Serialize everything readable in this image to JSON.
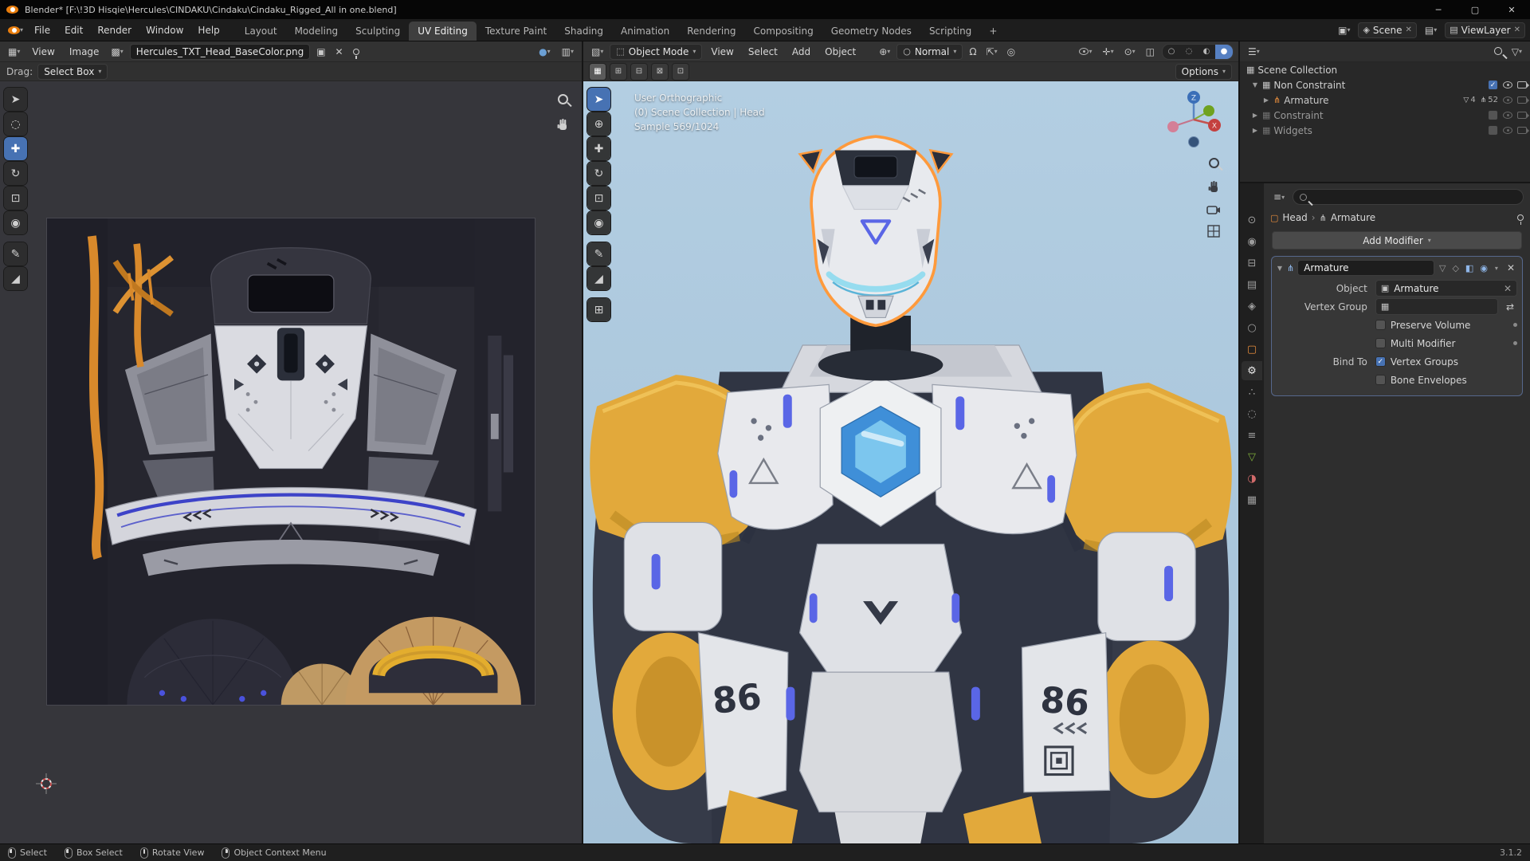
{
  "titlebar": {
    "title": "Blender* [F:\\!3D Hisqie\\Hercules\\CINDAKU\\Cindaku\\Cindaku_Rigged_All in one.blend]",
    "minimize": "─",
    "maximize": "▢",
    "close": "✕"
  },
  "topbar": {
    "menus": [
      "File",
      "Edit",
      "Render",
      "Window",
      "Help"
    ],
    "workspaces": [
      "Layout",
      "Modeling",
      "Sculpting",
      "UV Editing",
      "Texture Paint",
      "Shading",
      "Animation",
      "Rendering",
      "Compositing",
      "Geometry Nodes",
      "Scripting"
    ],
    "add_tab": "+",
    "scene_label": "Scene",
    "viewlayer_label": "ViewLayer"
  },
  "uv_editor": {
    "menu_view": "View",
    "menu_image": "Image",
    "image_name": "Hercules_TXT_Head_BaseColor.png",
    "drag_label": "Drag:",
    "drag_value": "Select Box"
  },
  "viewport": {
    "mode": "Object Mode",
    "menus": [
      "View",
      "Select",
      "Add",
      "Object"
    ],
    "orientation": "Normal",
    "options_label": "Options",
    "overlay_line1": "User Orthographic",
    "overlay_line2": "(0) Scene Collection | Head",
    "overlay_line3": "Sample 569/1024",
    "gizmo_axes": {
      "z": "Z",
      "x": "X"
    }
  },
  "outliner": {
    "scene_collection": "Scene Collection",
    "rows": [
      {
        "label": "Non Constraint"
      },
      {
        "label": "Armature",
        "count1": "4",
        "count2": "52"
      },
      {
        "label": "Constraint"
      },
      {
        "label": "Widgets"
      }
    ]
  },
  "properties": {
    "breadcrumb_object": "Head",
    "breadcrumb_modifier": "Armature",
    "add_modifier_label": "Add Modifier",
    "modifier": {
      "name": "Armature",
      "object_label": "Object",
      "object_value": "Armature",
      "vertex_group_label": "Vertex Group",
      "preserve_volume_label": "Preserve Volume",
      "multi_modifier_label": "Multi Modifier",
      "bind_to_label": "Bind To",
      "vertex_groups_label": "Vertex Groups",
      "bone_envelopes_label": "Bone Envelopes"
    }
  },
  "statusbar": {
    "hints": [
      "Select",
      "Box Select",
      "Rotate View",
      "Object Context Menu"
    ],
    "version": "3.1.2"
  },
  "robot": {
    "chest_text": "86"
  },
  "colors": {
    "accent": "#4772b3",
    "selection_outline": "#ff9a3c",
    "armor_yellow": "#e2a93b",
    "glow_blue": "#5a66e6",
    "sky": "#a9c5da"
  }
}
